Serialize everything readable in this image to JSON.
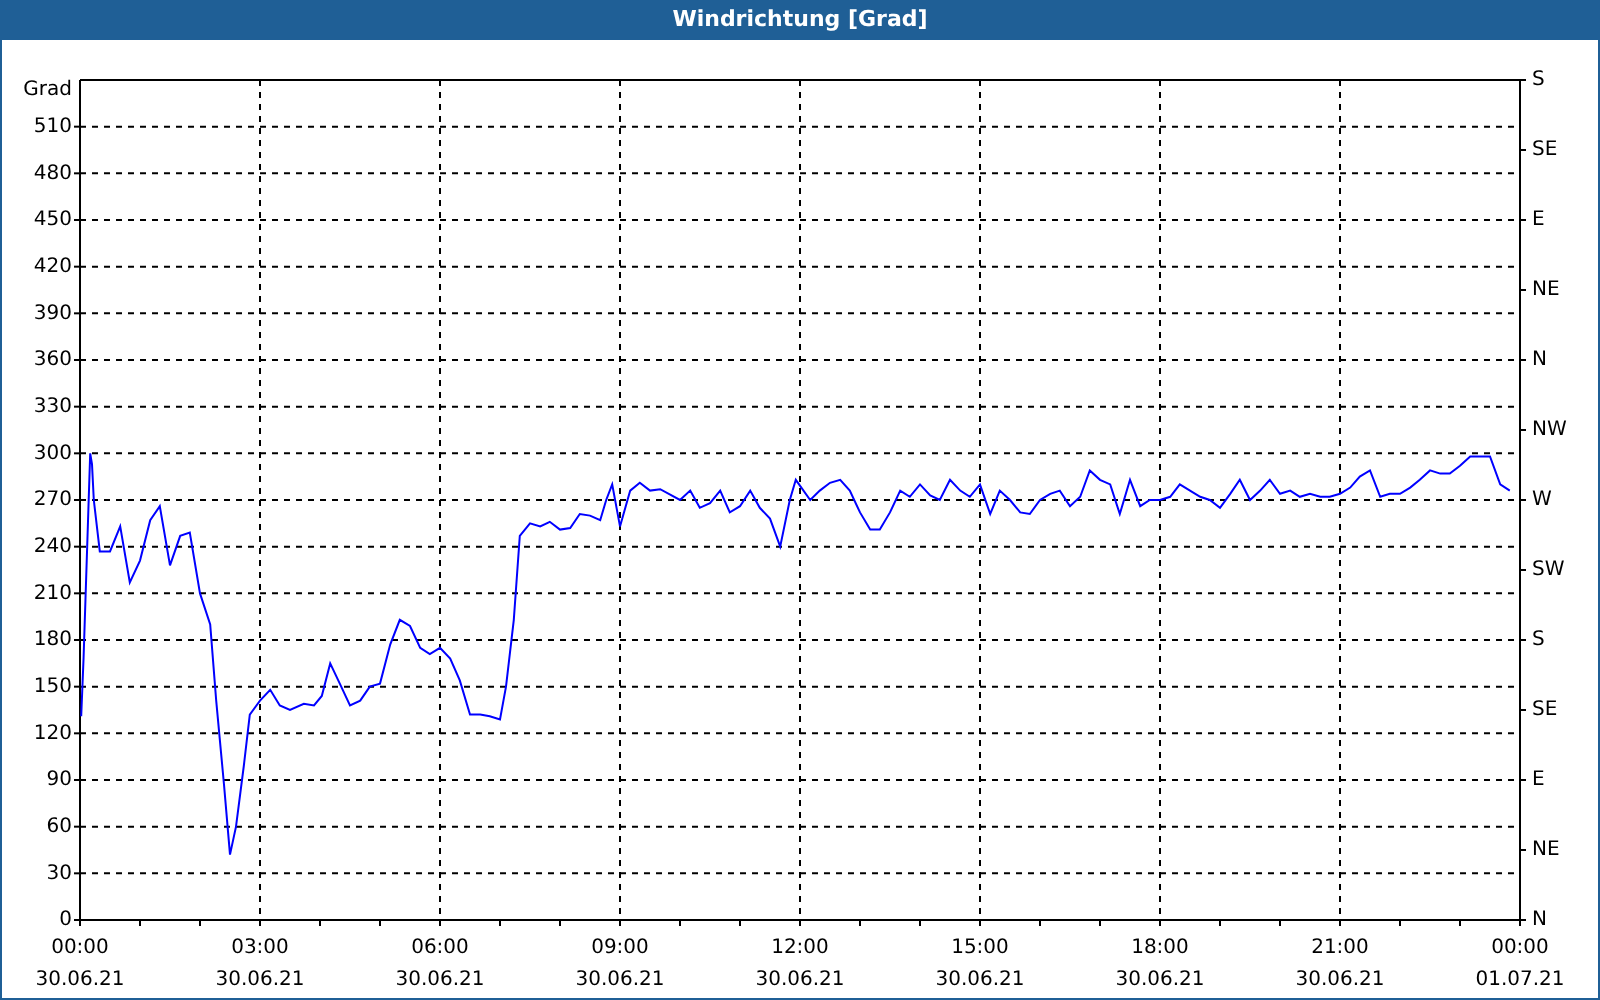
{
  "window": {
    "title": "Windrichtung [Grad]"
  },
  "chart": {
    "chart_data": {
      "type": "line",
      "grid": true,
      "ylabel": "Grad",
      "xlim": [
        0,
        24
      ],
      "ylim": [
        0,
        540
      ],
      "xticks": [
        {
          "value": 0,
          "label": "00:00"
        },
        {
          "value": 3,
          "label": "03:00"
        },
        {
          "value": 6,
          "label": "06:00"
        },
        {
          "value": 9,
          "label": "09:00"
        },
        {
          "value": 12,
          "label": "12:00"
        },
        {
          "value": 15,
          "label": "15:00"
        },
        {
          "value": 18,
          "label": "18:00"
        },
        {
          "value": 21,
          "label": "21:00"
        },
        {
          "value": 24,
          "label": "00:00"
        }
      ],
      "yticks": [
        0,
        30,
        60,
        90,
        120,
        150,
        180,
        210,
        240,
        270,
        300,
        330,
        360,
        390,
        420,
        450,
        480,
        510
      ],
      "x": [
        0.02,
        0.06,
        0.17,
        0.2,
        0.23,
        0.33,
        0.5,
        0.67,
        0.83,
        1.0,
        1.17,
        1.33,
        1.5,
        1.67,
        1.83,
        2.0,
        2.17,
        2.27,
        2.4,
        2.5,
        2.6,
        2.73,
        2.83,
        3.0,
        3.17,
        3.33,
        3.5,
        3.73,
        3.9,
        4.03,
        4.17,
        4.33,
        4.5,
        4.67,
        4.83,
        5.0,
        5.17,
        5.33,
        5.5,
        5.67,
        5.83,
        6.0,
        6.17,
        6.33,
        6.5,
        6.67,
        6.83,
        7.0,
        7.1,
        7.23,
        7.33,
        7.5,
        7.67,
        7.83,
        8.0,
        8.17,
        8.33,
        8.5,
        8.67,
        8.77,
        8.87,
        9.0,
        9.17,
        9.33,
        9.5,
        9.67,
        10.0,
        10.17,
        10.33,
        10.5,
        10.67,
        10.83,
        11.0,
        11.17,
        11.33,
        11.5,
        11.67,
        11.83,
        11.93,
        12.17,
        12.33,
        12.5,
        12.67,
        12.83,
        13.0,
        13.17,
        13.33,
        13.5,
        13.67,
        13.83,
        14.0,
        14.17,
        14.33,
        14.5,
        14.67,
        14.83,
        15.0,
        15.17,
        15.33,
        15.5,
        15.67,
        15.83,
        16.0,
        16.17,
        16.33,
        16.5,
        16.67,
        16.83,
        17.0,
        17.17,
        17.33,
        17.5,
        17.67,
        17.83,
        18.0,
        18.17,
        18.33,
        18.5,
        18.67,
        18.83,
        19.0,
        19.17,
        19.33,
        19.5,
        19.67,
        19.83,
        20.0,
        20.17,
        20.33,
        20.5,
        20.67,
        20.83,
        21.0,
        21.17,
        21.33,
        21.5,
        21.67,
        21.83,
        22.0,
        22.17,
        22.33,
        22.5,
        22.67,
        22.83,
        23.0,
        23.17,
        23.33,
        23.5,
        23.67,
        23.83
      ],
      "series": [
        {
          "color": "#0000ff",
          "values": [
            131,
            169,
            300,
            293,
            270,
            237,
            237,
            253,
            217,
            231,
            257,
            266,
            228,
            247,
            249,
            210,
            190,
            141,
            87,
            42,
            60,
            99,
            132,
            141,
            148,
            138,
            135,
            139,
            138,
            144,
            165,
            152,
            138,
            141,
            150,
            152,
            177,
            193,
            189,
            175,
            171,
            175,
            168,
            154,
            132,
            132,
            131,
            129,
            150,
            193,
            247,
            255,
            253,
            256,
            251,
            252,
            261,
            260,
            257,
            270,
            280,
            253,
            276,
            281,
            276,
            277,
            270,
            276,
            265,
            268,
            276,
            262,
            266,
            276,
            265,
            258,
            240,
            270,
            283,
            270,
            276,
            281,
            283,
            276,
            262,
            251,
            251,
            262,
            276,
            272,
            280,
            273,
            270,
            283,
            276,
            272,
            280,
            261,
            276,
            270,
            262,
            261,
            270,
            274,
            276,
            266,
            272,
            289,
            283,
            280,
            261,
            283,
            266,
            270,
            270,
            272,
            280,
            276,
            272,
            270,
            265,
            274,
            283,
            270,
            276,
            283,
            274,
            276,
            272,
            274,
            272,
            272,
            274,
            278,
            285,
            289,
            272,
            274,
            274,
            278,
            283,
            289,
            287,
            287,
            292,
            298,
            298,
            298,
            280,
            276
          ]
        }
      ]
    },
    "xtick_dates": [
      "30.06.21",
      "30.06.21",
      "30.06.21",
      "30.06.21",
      "30.06.21",
      "30.06.21",
      "30.06.21",
      "30.06.21",
      "01.07.21"
    ],
    "right_axis_labels": [
      "S",
      "SE",
      "E",
      "NE",
      "N",
      "NW",
      "W",
      "SW",
      "S",
      "SE",
      "E",
      "NE",
      "N"
    ]
  }
}
